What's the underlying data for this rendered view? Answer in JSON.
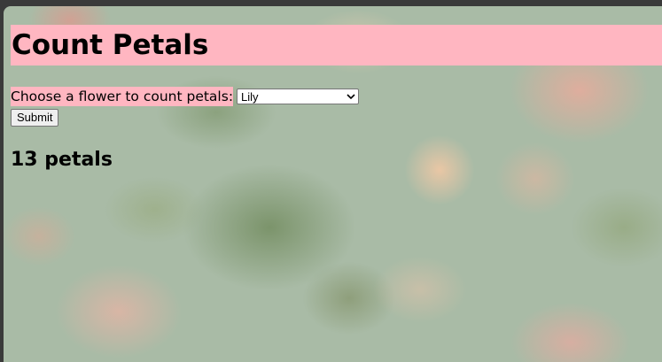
{
  "page": {
    "title": "Count Petals"
  },
  "form": {
    "label": "Choose a flower to count petals:",
    "selected_option": "Lily",
    "submit_label": "Submit"
  },
  "result": {
    "text": "13 petals"
  },
  "colors": {
    "highlight": "#ffb6c1",
    "background": "#a9bba6"
  },
  "icons": {
    "select_arrow": "chevron-down-icon"
  }
}
